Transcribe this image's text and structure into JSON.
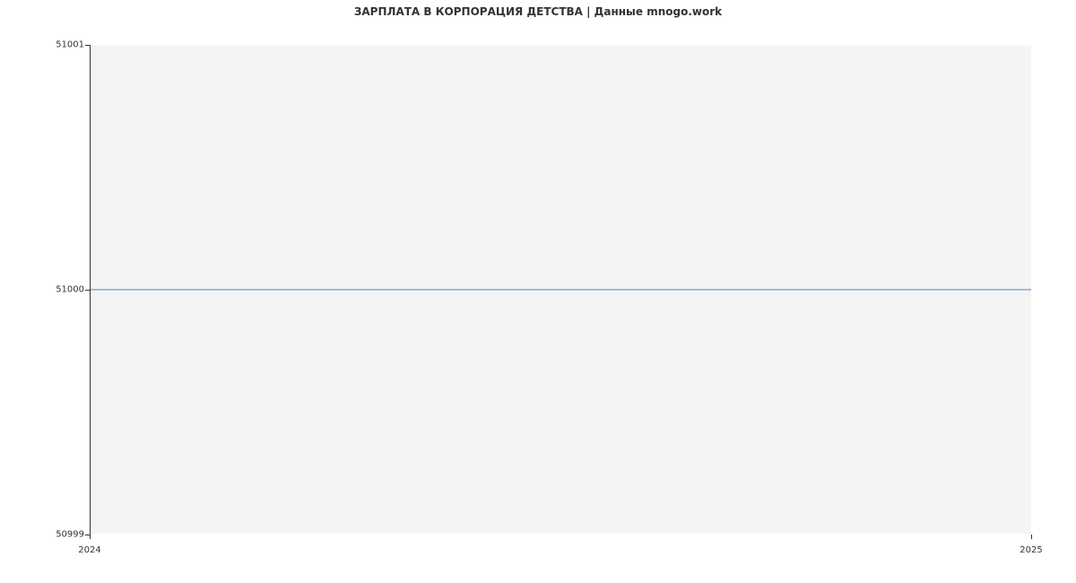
{
  "chart_data": {
    "type": "line",
    "title": "ЗАРПЛАТА В КОРПОРАЦИЯ ДЕТСТВА | Данные mnogo.work",
    "x": [
      2024,
      2025
    ],
    "values": [
      51000,
      51000
    ],
    "xlabel": "",
    "ylabel": "",
    "ylim": [
      50999,
      51001
    ],
    "xlim": [
      2024,
      2025
    ],
    "y_ticks": [
      "50999",
      "51000",
      "51001"
    ],
    "x_ticks": [
      "2024",
      "2025"
    ],
    "line_color": "#4a7fc4"
  }
}
